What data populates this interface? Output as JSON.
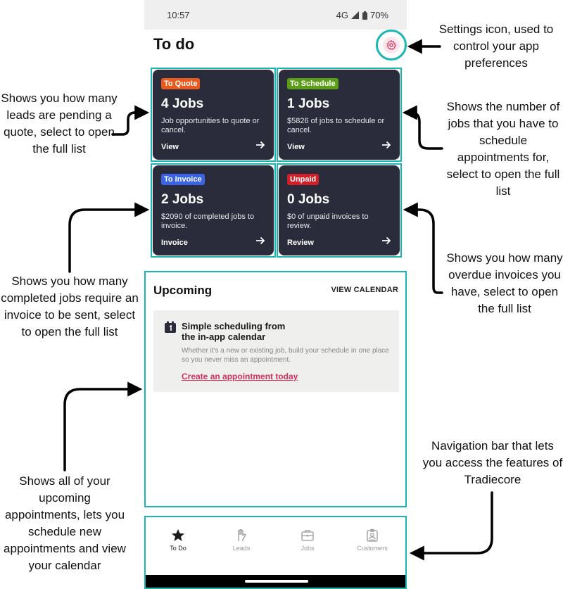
{
  "status": {
    "time": "10:57",
    "network": "4G",
    "battery": "70%"
  },
  "screen_title": "To do",
  "cards": [
    {
      "badge": "To Quote",
      "badge_color": "#e95a1c",
      "count": "4 Jobs",
      "desc": "Job opportunities to quote or cancel.",
      "action": "View"
    },
    {
      "badge": "To Schedule",
      "badge_color": "#5a9e17",
      "count": "1 Jobs",
      "desc": "$5826 of jobs to schedule or cancel.",
      "action": "View"
    },
    {
      "badge": "To Invoice",
      "badge_color": "#3b63e5",
      "count": "2 Jobs",
      "desc": "$2090 of completed jobs to invoice.",
      "action": "Invoice"
    },
    {
      "badge": "Unpaid",
      "badge_color": "#d11f2a",
      "count": "0 Jobs",
      "desc": "$0 of unpaid invoices to review.",
      "action": "Review"
    }
  ],
  "upcoming": {
    "title": "Upcoming",
    "view_calendar": "VIEW CALENDAR",
    "promo_heading_1": "Simple scheduling from",
    "promo_heading_2": "the in-app calendar",
    "promo_body": "Whether it's a new or existing job, build your schedule in one place so you never miss an appointment.",
    "promo_link": "Create an appointment today"
  },
  "nav": [
    {
      "label": "To Do",
      "icon": "star-icon",
      "active": true
    },
    {
      "label": "Leads",
      "icon": "hand-icon",
      "active": false
    },
    {
      "label": "Jobs",
      "icon": "briefcase-icon",
      "active": false
    },
    {
      "label": "Customers",
      "icon": "id-badge-icon",
      "active": false
    }
  ],
  "annotations": {
    "settings": "Settings icon, used to control your app preferences",
    "quote": "Shows you how many leads are pending a quote, select to open the full list",
    "schedule": "Shows the number of jobs that you have to schedule appointments for, select to open the full list",
    "invoice": "Shows you how many completed jobs require an invoice to be sent, select to open the full list",
    "unpaid": "Shows you how many overdue invoices you have, select to open the full list",
    "upcoming": "Shows all of your upcoming appointments, lets you schedule new appointments and view your calendar",
    "nav": "Navigation bar that lets you access the features of Tradiecore"
  },
  "colors": {
    "teal_outline": "#1bb5b5",
    "card_bg": "#2a2c3b",
    "accent": "#d22f5f"
  }
}
